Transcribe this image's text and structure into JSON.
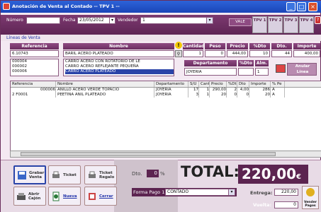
{
  "window": {
    "title": "Anotación de Venta al Contado -- TPV 1 --"
  },
  "header": {
    "numero_label": "Número",
    "numero_value": "",
    "fecha_label": "Fecha",
    "fecha_value": "23/05/2012",
    "vendedor_label": "Vendedor",
    "vendedor_value": "1",
    "vale_label": "VALE",
    "tpv_buttons": [
      "TPV 1",
      "TPV 2",
      "TPV 3",
      "TPV 4"
    ]
  },
  "section_title": "Líneas de Venta",
  "entry": {
    "referencia_header": "Referencia",
    "referencia_value": "6.10743",
    "referencia_list": [
      "000004",
      "000002",
      "000006"
    ],
    "nombre_header": "Nombre",
    "nombre_value": "BARIL ACERO PLATEADO",
    "nombre_list": [
      "CARRO ACERO CON ROTATORIO DE LE",
      "CARRO ACERO REFLEJANTE PEQUEÑA",
      "CARRO ACERO PLATEADO"
    ],
    "cantidad_header": "Cantidad",
    "cantidad_value": "1",
    "peso_header": "Peso",
    "peso_value": "0",
    "precio_header": "Precio",
    "precio_value": "444,00",
    "dto_header": "%Dto",
    "dto_value": "10",
    "dto_currency_header": "Dto.",
    "dto_currency_value": "44",
    "importe_header": "Importe",
    "importe_value": "400,00",
    "departamento_header": "Departamento",
    "departamento_value": "JOYERIA",
    "dto_iva_header": "%Dto",
    "alm_header": "Alm.",
    "alm_value": "1",
    "anular_label": "Anular Línea"
  },
  "grid": {
    "columns": [
      "Referencia",
      "Nombre",
      "Departamento",
      "S/U",
      "Cant",
      "Precio",
      "%Dto",
      "Dto",
      "Importe",
      "% Pe"
    ],
    "rows": [
      [
        "000006",
        "ANILLO ACERO VERDE TOPACIO",
        "JOYERIA",
        "17",
        "1",
        "290,00",
        "2",
        "4,00",
        "286",
        "A"
      ],
      [
        "2 F0001",
        "PEETINA ANIL PLATEADO",
        "JOYERIA",
        "3",
        "1",
        "20",
        "0",
        "0",
        "20",
        "A"
      ]
    ]
  },
  "actions": {
    "grabar": "Grabar Venta",
    "ticket": "Ticket",
    "ticket_regalo": "Ticket Regalo",
    "abrir_cajon": "Abrir Cajón",
    "nueva": "Nueva",
    "cerrar": "Cerrar"
  },
  "totals": {
    "dto_label": "Dto.",
    "dto_value": "0",
    "dto_unit": "%",
    "total_label": "TOTAL:",
    "total_value": "220,00",
    "currency": "€",
    "forma_pago_label": "Forma Pago 1:",
    "forma_pago_value": "CONTADO",
    "entrega_label": "Entrega:",
    "entrega_value": "220,00",
    "vuelta_label": "Vuelta:",
    "vuelta_value": "0",
    "vender_pagos_label": "Vender Pagos"
  },
  "colors": {
    "accent": "#5c2450",
    "title": "#1a45b8"
  }
}
